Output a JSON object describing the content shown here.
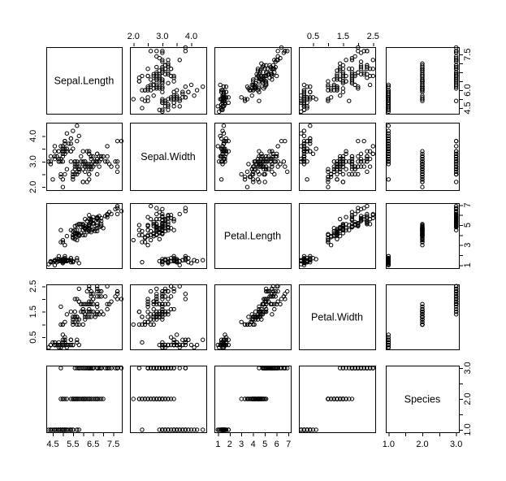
{
  "plot": {
    "type": "pairs-scatterplot-matrix",
    "background": "#ffffff",
    "point_color": "#000000",
    "frame_color": "#000000",
    "point_symbol": "open-circle",
    "point_radius_px": 2.2
  },
  "chart_data": {
    "type": "scatter",
    "title": "",
    "subtitle": "",
    "xlabel": "",
    "ylabel": "",
    "grid": false,
    "legend": "none",
    "layout": "5x5 scatterplot matrix (pairs plot), diagonal shows variable names",
    "variables": [
      {
        "name": "Sepal.Length",
        "index": 0,
        "axis_side_top": false,
        "axis_side_bottom": true,
        "axis_side_left": false,
        "axis_side_right": true,
        "lim": [
          4.18,
          7.92
        ],
        "ticks": [
          4.5,
          5.0,
          5.5,
          6.0,
          6.5,
          7.0,
          7.5
        ],
        "tick_labels": [
          "4.5",
          "",
          "5.5",
          "",
          "6.5",
          "",
          "7.5"
        ],
        "right_ticks": [
          4.5,
          5.0,
          5.5,
          6.0,
          6.5,
          7.0,
          7.5
        ],
        "right_tick_labels": [
          "4.5",
          "",
          "6.0",
          "",
          "",
          "",
          "7.5"
        ]
      },
      {
        "name": "Sepal.Width",
        "index": 1,
        "axis_side_top": true,
        "axis_side_bottom": false,
        "axis_side_left": true,
        "axis_side_right": false,
        "lim": [
          1.88,
          4.52
        ],
        "ticks": [
          2.0,
          2.5,
          3.0,
          3.5,
          4.0
        ],
        "tick_labels": [
          "2.0",
          "",
          "3.0",
          "",
          "4.0"
        ],
        "left_ticks": [
          2.0,
          2.5,
          3.0,
          3.5,
          4.0
        ],
        "left_tick_labels": [
          "2.0",
          "",
          "3.0",
          "",
          "4.0"
        ]
      },
      {
        "name": "Petal.Length",
        "index": 2,
        "axis_side_top": false,
        "axis_side_bottom": true,
        "axis_side_left": false,
        "axis_side_right": true,
        "lim": [
          0.705,
          7.195
        ],
        "ticks": [
          1,
          2,
          3,
          4,
          5,
          6,
          7
        ],
        "tick_labels": [
          "1",
          "2",
          "3",
          "4",
          "5",
          "6",
          "7"
        ],
        "right_ticks": [
          1,
          2,
          3,
          4,
          5,
          6,
          7
        ],
        "right_tick_labels": [
          "1",
          "",
          "3",
          "",
          "5",
          "",
          "7"
        ]
      },
      {
        "name": "Petal.Width",
        "index": 3,
        "axis_side_top": true,
        "axis_side_bottom": false,
        "axis_side_left": true,
        "axis_side_right": false,
        "lim": [
          0.026,
          2.574
        ],
        "ticks": [
          0.5,
          1.0,
          1.5,
          2.0,
          2.5
        ],
        "tick_labels": [
          "0.5",
          "",
          "1.5",
          "",
          "2.5"
        ],
        "left_ticks": [
          0.5,
          1.0,
          1.5,
          2.0,
          2.5
        ],
        "left_tick_labels": [
          "0.5",
          "",
          "1.5",
          "",
          "2.5"
        ]
      },
      {
        "name": "Species",
        "index": 4,
        "axis_side_top": false,
        "axis_side_bottom": true,
        "axis_side_left": false,
        "axis_side_right": true,
        "lim": [
          0.92,
          3.08
        ],
        "ticks": [
          1.0,
          1.5,
          2.0,
          2.5,
          3.0
        ],
        "tick_labels": [
          "1.0",
          "",
          "2.0",
          "",
          "3.0"
        ],
        "right_ticks": [
          1.0,
          1.5,
          2.0,
          2.5,
          3.0
        ],
        "right_tick_labels": [
          "1.0",
          "",
          "2.0",
          "",
          "3.0"
        ]
      }
    ],
    "n_points": 150,
    "columns": [
      "Sepal.Length",
      "Sepal.Width",
      "Petal.Length",
      "Petal.Width",
      "Species"
    ],
    "rows": [
      [
        5.1,
        3.5,
        1.4,
        0.2,
        1
      ],
      [
        4.9,
        3.0,
        1.4,
        0.2,
        1
      ],
      [
        4.7,
        3.2,
        1.3,
        0.2,
        1
      ],
      [
        4.6,
        3.1,
        1.5,
        0.2,
        1
      ],
      [
        5.0,
        3.6,
        1.4,
        0.2,
        1
      ],
      [
        5.4,
        3.9,
        1.7,
        0.4,
        1
      ],
      [
        4.6,
        3.4,
        1.4,
        0.3,
        1
      ],
      [
        5.0,
        3.4,
        1.5,
        0.2,
        1
      ],
      [
        4.4,
        2.9,
        1.4,
        0.2,
        1
      ],
      [
        4.9,
        3.1,
        1.5,
        0.1,
        1
      ],
      [
        5.4,
        3.7,
        1.5,
        0.2,
        1
      ],
      [
        4.8,
        3.4,
        1.6,
        0.2,
        1
      ],
      [
        4.8,
        3.0,
        1.4,
        0.1,
        1
      ],
      [
        4.3,
        3.0,
        1.1,
        0.1,
        1
      ],
      [
        5.8,
        4.0,
        1.2,
        0.2,
        1
      ],
      [
        5.7,
        4.4,
        1.5,
        0.4,
        1
      ],
      [
        5.4,
        3.9,
        1.3,
        0.4,
        1
      ],
      [
        5.1,
        3.5,
        1.4,
        0.3,
        1
      ],
      [
        5.7,
        3.8,
        1.7,
        0.3,
        1
      ],
      [
        5.1,
        3.8,
        1.5,
        0.3,
        1
      ],
      [
        5.4,
        3.4,
        1.7,
        0.2,
        1
      ],
      [
        5.1,
        3.7,
        1.5,
        0.4,
        1
      ],
      [
        4.6,
        3.6,
        1.0,
        0.2,
        1
      ],
      [
        5.1,
        3.3,
        1.7,
        0.5,
        1
      ],
      [
        4.8,
        3.4,
        1.9,
        0.2,
        1
      ],
      [
        5.0,
        3.0,
        1.6,
        0.2,
        1
      ],
      [
        5.0,
        3.4,
        1.6,
        0.4,
        1
      ],
      [
        5.2,
        3.5,
        1.5,
        0.2,
        1
      ],
      [
        5.2,
        3.4,
        1.4,
        0.2,
        1
      ],
      [
        4.7,
        3.2,
        1.6,
        0.2,
        1
      ],
      [
        4.8,
        3.1,
        1.6,
        0.2,
        1
      ],
      [
        5.4,
        3.4,
        1.5,
        0.4,
        1
      ],
      [
        5.2,
        4.1,
        1.5,
        0.1,
        1
      ],
      [
        5.5,
        4.2,
        1.4,
        0.2,
        1
      ],
      [
        4.9,
        3.1,
        1.5,
        0.2,
        1
      ],
      [
        5.0,
        3.2,
        1.2,
        0.2,
        1
      ],
      [
        5.5,
        3.5,
        1.3,
        0.2,
        1
      ],
      [
        4.9,
        3.6,
        1.4,
        0.1,
        1
      ],
      [
        4.4,
        3.0,
        1.3,
        0.2,
        1
      ],
      [
        5.1,
        3.4,
        1.5,
        0.2,
        1
      ],
      [
        5.0,
        3.5,
        1.3,
        0.3,
        1
      ],
      [
        4.5,
        2.3,
        1.3,
        0.3,
        1
      ],
      [
        4.4,
        3.2,
        1.3,
        0.2,
        1
      ],
      [
        5.0,
        3.5,
        1.6,
        0.6,
        1
      ],
      [
        5.1,
        3.8,
        1.9,
        0.4,
        1
      ],
      [
        4.8,
        3.0,
        1.4,
        0.3,
        1
      ],
      [
        5.1,
        3.8,
        1.6,
        0.2,
        1
      ],
      [
        4.6,
        3.2,
        1.4,
        0.2,
        1
      ],
      [
        5.3,
        3.7,
        1.5,
        0.2,
        1
      ],
      [
        5.0,
        3.3,
        1.4,
        0.2,
        1
      ],
      [
        7.0,
        3.2,
        4.7,
        1.4,
        2
      ],
      [
        6.4,
        3.2,
        4.5,
        1.5,
        2
      ],
      [
        6.9,
        3.1,
        4.9,
        1.5,
        2
      ],
      [
        5.5,
        2.3,
        4.0,
        1.3,
        2
      ],
      [
        6.5,
        2.8,
        4.6,
        1.5,
        2
      ],
      [
        5.7,
        2.8,
        4.5,
        1.3,
        2
      ],
      [
        6.3,
        3.3,
        4.7,
        1.6,
        2
      ],
      [
        4.9,
        2.4,
        3.3,
        1.0,
        2
      ],
      [
        6.6,
        2.9,
        4.6,
        1.3,
        2
      ],
      [
        5.2,
        2.7,
        3.9,
        1.4,
        2
      ],
      [
        5.0,
        2.0,
        3.5,
        1.0,
        2
      ],
      [
        5.9,
        3.0,
        4.2,
        1.5,
        2
      ],
      [
        6.0,
        2.2,
        4.0,
        1.0,
        2
      ],
      [
        6.1,
        2.9,
        4.7,
        1.4,
        2
      ],
      [
        5.6,
        2.9,
        3.6,
        1.3,
        2
      ],
      [
        6.7,
        3.1,
        4.4,
        1.4,
        2
      ],
      [
        5.6,
        3.0,
        4.5,
        1.5,
        2
      ],
      [
        5.8,
        2.7,
        4.1,
        1.0,
        2
      ],
      [
        6.2,
        2.2,
        4.5,
        1.5,
        2
      ],
      [
        5.6,
        2.5,
        3.9,
        1.1,
        2
      ],
      [
        5.9,
        3.2,
        4.8,
        1.8,
        2
      ],
      [
        6.1,
        2.8,
        4.0,
        1.3,
        2
      ],
      [
        6.3,
        2.5,
        4.9,
        1.5,
        2
      ],
      [
        6.1,
        2.8,
        4.7,
        1.2,
        2
      ],
      [
        6.4,
        2.9,
        4.3,
        1.3,
        2
      ],
      [
        6.6,
        3.0,
        4.4,
        1.4,
        2
      ],
      [
        6.8,
        2.8,
        4.8,
        1.4,
        2
      ],
      [
        6.7,
        3.0,
        5.0,
        1.7,
        2
      ],
      [
        6.0,
        2.9,
        4.5,
        1.5,
        2
      ],
      [
        5.7,
        2.6,
        3.5,
        1.0,
        2
      ],
      [
        5.5,
        2.4,
        3.8,
        1.1,
        2
      ],
      [
        5.5,
        2.4,
        3.7,
        1.0,
        2
      ],
      [
        5.8,
        2.7,
        3.9,
        1.2,
        2
      ],
      [
        6.0,
        2.7,
        5.1,
        1.6,
        2
      ],
      [
        5.4,
        3.0,
        4.5,
        1.5,
        2
      ],
      [
        6.0,
        3.4,
        4.5,
        1.6,
        2
      ],
      [
        6.7,
        3.1,
        4.7,
        1.5,
        2
      ],
      [
        6.3,
        2.3,
        4.4,
        1.3,
        2
      ],
      [
        5.6,
        3.0,
        4.1,
        1.3,
        2
      ],
      [
        5.5,
        2.5,
        4.0,
        1.3,
        2
      ],
      [
        5.5,
        2.6,
        4.4,
        1.2,
        2
      ],
      [
        6.1,
        3.0,
        4.6,
        1.4,
        2
      ],
      [
        5.8,
        2.6,
        4.0,
        1.2,
        2
      ],
      [
        5.0,
        2.3,
        3.3,
        1.0,
        2
      ],
      [
        5.6,
        2.7,
        4.2,
        1.3,
        2
      ],
      [
        5.7,
        3.0,
        4.2,
        1.2,
        2
      ],
      [
        5.7,
        2.9,
        4.2,
        1.3,
        2
      ],
      [
        6.2,
        2.9,
        4.3,
        1.3,
        2
      ],
      [
        5.1,
        2.5,
        3.0,
        1.1,
        2
      ],
      [
        5.7,
        2.8,
        4.1,
        1.3,
        2
      ],
      [
        6.3,
        3.3,
        6.0,
        2.5,
        3
      ],
      [
        5.8,
        2.7,
        5.1,
        1.9,
        3
      ],
      [
        7.1,
        3.0,
        5.9,
        2.1,
        3
      ],
      [
        6.3,
        2.9,
        5.6,
        1.8,
        3
      ],
      [
        6.5,
        3.0,
        5.8,
        2.2,
        3
      ],
      [
        7.6,
        3.0,
        6.6,
        2.1,
        3
      ],
      [
        4.9,
        2.5,
        4.5,
        1.7,
        3
      ],
      [
        7.3,
        2.9,
        6.3,
        1.8,
        3
      ],
      [
        6.7,
        2.5,
        5.8,
        1.8,
        3
      ],
      [
        7.2,
        3.6,
        6.1,
        2.5,
        3
      ],
      [
        6.5,
        3.2,
        5.1,
        2.0,
        3
      ],
      [
        6.4,
        2.7,
        5.3,
        1.9,
        3
      ],
      [
        6.8,
        3.0,
        5.5,
        2.1,
        3
      ],
      [
        5.7,
        2.5,
        5.0,
        2.0,
        3
      ],
      [
        5.8,
        2.8,
        5.1,
        2.4,
        3
      ],
      [
        6.4,
        3.2,
        5.3,
        2.3,
        3
      ],
      [
        6.5,
        3.0,
        5.5,
        1.8,
        3
      ],
      [
        7.7,
        3.8,
        6.7,
        2.2,
        3
      ],
      [
        7.7,
        2.6,
        6.9,
        2.3,
        3
      ],
      [
        6.0,
        2.2,
        5.0,
        1.5,
        3
      ],
      [
        6.9,
        3.2,
        5.7,
        2.3,
        3
      ],
      [
        5.6,
        2.8,
        4.9,
        2.0,
        3
      ],
      [
        7.7,
        2.8,
        6.7,
        2.0,
        3
      ],
      [
        6.3,
        2.7,
        4.9,
        1.8,
        3
      ],
      [
        6.7,
        3.3,
        5.7,
        2.1,
        3
      ],
      [
        7.2,
        3.2,
        6.0,
        1.8,
        3
      ],
      [
        6.2,
        2.8,
        4.8,
        1.8,
        3
      ],
      [
        6.1,
        3.0,
        4.9,
        1.8,
        3
      ],
      [
        6.4,
        2.8,
        5.6,
        2.1,
        3
      ],
      [
        7.2,
        3.0,
        5.8,
        1.6,
        3
      ],
      [
        7.4,
        2.8,
        6.1,
        1.9,
        3
      ],
      [
        7.9,
        3.8,
        6.4,
        2.0,
        3
      ],
      [
        6.4,
        2.8,
        5.6,
        2.2,
        3
      ],
      [
        6.3,
        2.8,
        5.1,
        1.5,
        3
      ],
      [
        6.1,
        2.6,
        5.6,
        1.4,
        3
      ],
      [
        7.7,
        3.0,
        6.1,
        2.3,
        3
      ],
      [
        6.3,
        3.4,
        5.6,
        2.4,
        3
      ],
      [
        6.4,
        3.1,
        5.5,
        1.8,
        3
      ],
      [
        6.0,
        3.0,
        4.8,
        1.8,
        3
      ],
      [
        6.9,
        3.1,
        5.4,
        2.1,
        3
      ],
      [
        6.7,
        3.1,
        5.6,
        2.4,
        3
      ],
      [
        6.9,
        3.1,
        5.1,
        2.3,
        3
      ],
      [
        5.8,
        2.7,
        5.1,
        1.9,
        3
      ],
      [
        6.8,
        3.2,
        5.9,
        2.3,
        3
      ],
      [
        6.7,
        3.3,
        5.7,
        2.5,
        3
      ],
      [
        6.7,
        3.0,
        5.2,
        2.3,
        3
      ],
      [
        6.3,
        2.5,
        5.0,
        1.9,
        3
      ],
      [
        6.5,
        3.0,
        5.2,
        2.0,
        3
      ],
      [
        6.2,
        3.4,
        5.4,
        2.3,
        3
      ],
      [
        5.9,
        3.0,
        5.1,
        1.8,
        3
      ]
    ]
  }
}
